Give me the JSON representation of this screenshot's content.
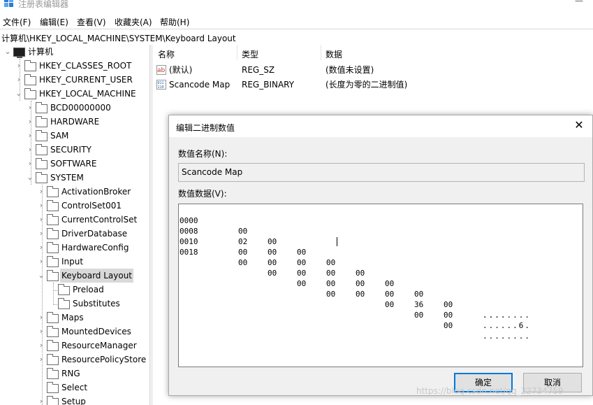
{
  "window": {
    "title": "注册表编辑器",
    "controls": "—"
  },
  "menu": [
    "文件(F)",
    "编辑(E)",
    "查看(V)",
    "收藏夹(A)",
    "帮助(H)"
  ],
  "address": "计算机\\HKEY_LOCAL_MACHINE\\SYSTEM\\Keyboard Layout",
  "tree": {
    "root": "计算机",
    "items": [
      "HKEY_CLASSES_ROOT",
      "HKEY_CURRENT_USER",
      "HKEY_LOCAL_MACHINE",
      "BCD00000000",
      "HARDWARE",
      "SAM",
      "SECURITY",
      "SOFTWARE",
      "SYSTEM",
      "ActivationBroker",
      "ControlSet001",
      "CurrentControlSet",
      "DriverDatabase",
      "HardwareConfig",
      "Input",
      "Keyboard Layout",
      "Preload",
      "Substitutes",
      "Maps",
      "MountedDevices",
      "ResourceManager",
      "ResourcePolicyStore",
      "RNG",
      "Select",
      "Setup"
    ],
    "selected": "Keyboard Layout"
  },
  "list": {
    "headers": {
      "name": "名称",
      "type": "类型",
      "data": "数据"
    },
    "rows": [
      {
        "name": "(默认)",
        "type": "REG_SZ",
        "data": "(数值未设置)",
        "icon": "string-value-icon"
      },
      {
        "name": "Scancode Map",
        "type": "REG_BINARY",
        "data": "(长度为零的二进制值)",
        "icon": "binary-value-icon"
      }
    ]
  },
  "dialog": {
    "title": "编辑二进制数值",
    "name_label": "数值名称(N):",
    "name_value": "Scancode Map",
    "data_label": "数值数据(V):",
    "hex_rows": [
      {
        "addr": "0000",
        "bytes": [
          "00",
          "00",
          "00",
          "00",
          "00",
          "00",
          "00",
          "00"
        ],
        "ascii": "........"
      },
      {
        "addr": "0008",
        "bytes": [
          "02",
          "00",
          "00",
          "00",
          "00",
          "00",
          "36",
          "00"
        ],
        "ascii": "......6."
      },
      {
        "addr": "0010",
        "bytes": [
          "00",
          "00",
          "00",
          "00",
          "00",
          "00",
          "00",
          "00"
        ],
        "ascii": "........"
      },
      {
        "addr": "0018",
        "bytes": [
          "00",
          "00",
          "00",
          "00"
        ],
        "ascii": "...."
      }
    ],
    "ok": "确定",
    "cancel": "取消"
  },
  "watermark": "https://blog.csdn.net/qq_22734759"
}
